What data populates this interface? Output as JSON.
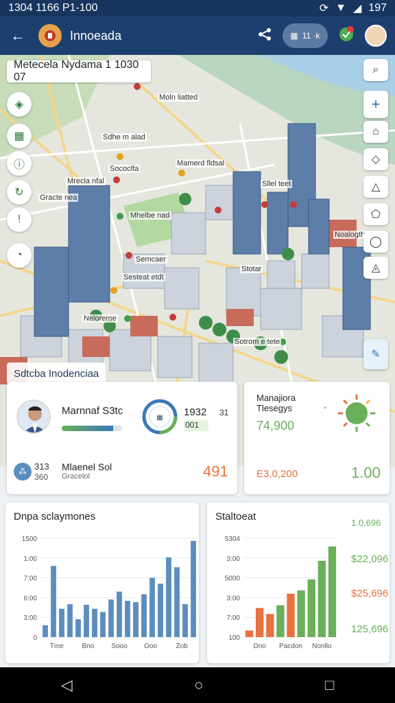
{
  "status": {
    "time": "1304 1166 P1-100",
    "battery": "197"
  },
  "appbar": {
    "title": "Innoeada",
    "pill_label": "11 ·k"
  },
  "map": {
    "search_title": "Metecela Nydama  1 1030 07",
    "labels": [
      "Moln liatted",
      "Sdhe m alad",
      "Sococlfa",
      "Mamerd fldsal",
      "Mrecla nfal",
      "Sllel teet",
      "Gracte nea",
      "Mhelbe nad",
      "Semcaer",
      "Stotar",
      "Sesteat etdt",
      "Neloreme",
      "Sotrom e tete",
      "Noalogth"
    ],
    "district": "Sdtcba  Inodenciaa"
  },
  "card_user": {
    "name": "Marnnaf S3tc",
    "progress": 0.85,
    "gauge_value": "1932",
    "gauge_side": "31",
    "gauge_sub": "001",
    "stat_a": "313",
    "stat_b": "360",
    "label": "Mlaenel Sol",
    "sub": "Gracelol",
    "big_value": "491"
  },
  "card_mana": {
    "title": "Manajiora Tlesegys",
    "value": "74,900",
    "money": "E3,0,200",
    "ratio": "1.00"
  },
  "chart_left": {
    "title": "Dnpa  sclaymones",
    "yticks": [
      "1500",
      "1:00",
      "7:00",
      "6:00",
      "3:00",
      "0"
    ],
    "xticks": [
      "Tme",
      "Bno",
      "Sooo",
      "Ooo",
      "Zob"
    ]
  },
  "chart_right": {
    "title": "Staltoeat",
    "yticks": [
      "5304",
      "3:00",
      "5000",
      "3:00",
      "7:00",
      "100"
    ],
    "xticks": [
      "Dno",
      "Pacdon",
      "Nonllo"
    ],
    "side_values": [
      "1.0,696",
      "$22,096",
      "$25,696",
      "125,696"
    ]
  },
  "chart_data": [
    {
      "type": "bar",
      "title": "Dnpa  sclaymones",
      "values": [
        180,
        1080,
        430,
        500,
        270,
        490,
        430,
        380,
        570,
        690,
        550,
        530,
        650,
        900,
        810,
        1210,
        1060,
        500,
        1460
      ],
      "ylim": [
        0,
        1500
      ],
      "color": "#5b8dbf"
    },
    {
      "type": "bar",
      "title": "Staltoeat",
      "values": [
        120,
        530,
        420,
        580,
        790,
        850,
        1050,
        1390,
        1650
      ],
      "colors": [
        "#e8713f",
        "#e8713f",
        "#e8713f",
        "#6aaf5a",
        "#e8713f",
        "#6aaf5a",
        "#6aaf5a",
        "#6aaf5a",
        "#6aaf5a"
      ],
      "ylim": [
        0,
        1800
      ]
    }
  ],
  "colors": {
    "appbar": "#1d3f6e",
    "accent_blue": "#3c79b8",
    "accent_green": "#6aaf5a",
    "accent_orange": "#e8713f"
  }
}
